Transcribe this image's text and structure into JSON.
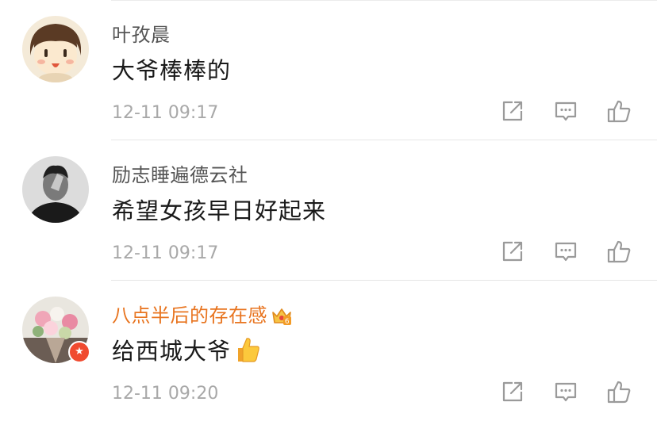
{
  "comments": [
    {
      "username": "叶孜晨",
      "text": "大爷棒棒的",
      "time": "12-11 09:17",
      "vip": false
    },
    {
      "username": "励志睡遍德云社",
      "text": "希望女孩早日好起来",
      "time": "12-11 09:17",
      "vip": false
    },
    {
      "username": "八点半后的存在感",
      "text": "给西城大爷",
      "time": "12-11 09:20",
      "vip": true,
      "verified": true,
      "emoji": "thumbs-up-emoji"
    }
  ],
  "colors": {
    "vip_name": "#e8741f",
    "name": "#555555",
    "text": "#1a1a1a",
    "meta": "#a8a8a8",
    "icon": "#9a9a9a",
    "verified_badge": "#f04a2f"
  },
  "icons": [
    "share-icon",
    "reply-icon",
    "like-icon",
    "crown-icon",
    "verified-icon"
  ]
}
